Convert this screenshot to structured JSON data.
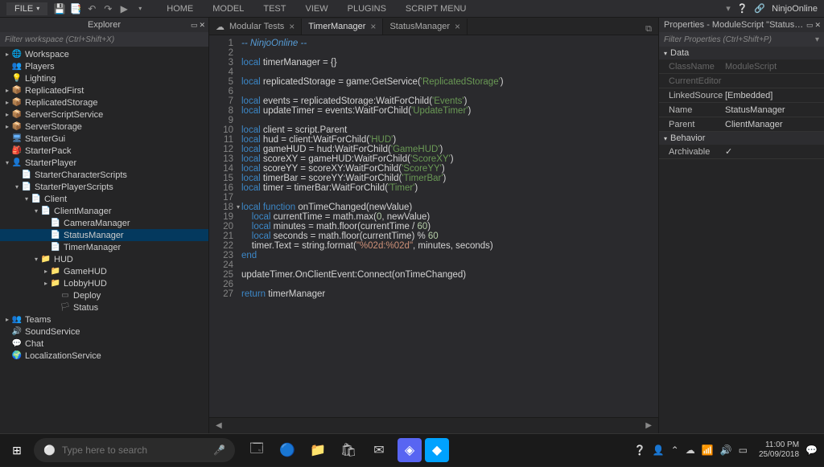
{
  "menubar": {
    "file_label": "FILE",
    "tabs": [
      "HOME",
      "MODEL",
      "TEST",
      "VIEW",
      "PLUGINS",
      "SCRIPT MENU"
    ],
    "username": "NinjoOnline"
  },
  "explorer": {
    "title": "Explorer",
    "filter_placeholder": "Filter workspace (Ctrl+Shift+X)",
    "tree": [
      {
        "indent": 0,
        "arrow": ">",
        "icon": "🌐",
        "cls": "ic-workspace",
        "label": "Workspace"
      },
      {
        "indent": 0,
        "arrow": "",
        "icon": "👥",
        "cls": "ic-players",
        "label": "Players"
      },
      {
        "indent": 0,
        "arrow": "",
        "icon": "💡",
        "cls": "ic-lighting",
        "label": "Lighting"
      },
      {
        "indent": 0,
        "arrow": ">",
        "icon": "📦",
        "cls": "ic-folder",
        "label": "ReplicatedFirst"
      },
      {
        "indent": 0,
        "arrow": ">",
        "icon": "📦",
        "cls": "ic-folder",
        "label": "ReplicatedStorage"
      },
      {
        "indent": 0,
        "arrow": ">",
        "icon": "📦",
        "cls": "ic-folder",
        "label": "ServerScriptService"
      },
      {
        "indent": 0,
        "arrow": ">",
        "icon": "📦",
        "cls": "ic-folder",
        "label": "ServerStorage"
      },
      {
        "indent": 0,
        "arrow": "",
        "icon": "🖥",
        "cls": "ic-gui",
        "label": "StarterGui"
      },
      {
        "indent": 0,
        "arrow": "",
        "icon": "🎒",
        "cls": "ic-folder",
        "label": "StarterPack"
      },
      {
        "indent": 0,
        "arrow": "v",
        "icon": "👤",
        "cls": "ic-players",
        "label": "StarterPlayer"
      },
      {
        "indent": 1,
        "arrow": "",
        "icon": "📄",
        "cls": "ic-script",
        "label": "StarterCharacterScripts"
      },
      {
        "indent": 1,
        "arrow": "v",
        "icon": "📄",
        "cls": "ic-script",
        "label": "StarterPlayerScripts"
      },
      {
        "indent": 2,
        "arrow": "v",
        "icon": "📄",
        "cls": "ic-script",
        "label": "Client"
      },
      {
        "indent": 3,
        "arrow": "v",
        "icon": "📄",
        "cls": "ic-module",
        "label": "ClientManager"
      },
      {
        "indent": 4,
        "arrow": "",
        "icon": "📄",
        "cls": "ic-module",
        "label": "CameraManager"
      },
      {
        "indent": 4,
        "arrow": "",
        "icon": "📄",
        "cls": "ic-module",
        "label": "StatusManager",
        "selected": true
      },
      {
        "indent": 4,
        "arrow": "",
        "icon": "📄",
        "cls": "ic-module",
        "label": "TimerManager"
      },
      {
        "indent": 3,
        "arrow": "v",
        "icon": "📁",
        "cls": "ic-folder",
        "label": "HUD"
      },
      {
        "indent": 4,
        "arrow": ">",
        "icon": "📁",
        "cls": "ic-folder",
        "label": "GameHUD"
      },
      {
        "indent": 4,
        "arrow": ">",
        "icon": "📁",
        "cls": "ic-folder",
        "label": "LobbyHUD"
      },
      {
        "indent": 5,
        "arrow": "",
        "icon": "▭",
        "cls": "ic-frame",
        "label": "Deploy"
      },
      {
        "indent": 5,
        "arrow": "",
        "icon": "🏳",
        "cls": "ic-frame",
        "label": "Status"
      },
      {
        "indent": 0,
        "arrow": ">",
        "icon": "👥",
        "cls": "ic-players",
        "label": "Teams"
      },
      {
        "indent": 0,
        "arrow": "",
        "icon": "🔊",
        "cls": "ic-service",
        "label": "SoundService"
      },
      {
        "indent": 0,
        "arrow": "",
        "icon": "💬",
        "cls": "ic-service",
        "label": "Chat"
      },
      {
        "indent": 0,
        "arrow": "",
        "icon": "🌍",
        "cls": "ic-service",
        "label": "LocalizationService"
      }
    ]
  },
  "editor": {
    "tabs": [
      {
        "icon": "☁",
        "label": "Modular Tests",
        "active": false
      },
      {
        "icon": "",
        "label": "TimerManager",
        "active": true
      },
      {
        "icon": "",
        "label": "StatusManager",
        "active": false
      }
    ],
    "code_lines": [
      {
        "n": 1,
        "html": "<span class='cmt'>-- NinjoOnline --</span>"
      },
      {
        "n": 2,
        "html": ""
      },
      {
        "n": 3,
        "html": "<span class='kw'>local</span> timerManager = {}"
      },
      {
        "n": 4,
        "html": ""
      },
      {
        "n": 5,
        "html": "<span class='kw'>local</span> replicatedStorage = game:GetService(<span class='str2'>'ReplicatedStorage'</span>)"
      },
      {
        "n": 6,
        "html": ""
      },
      {
        "n": 7,
        "html": "<span class='kw'>local</span> events = replicatedStorage:WaitForChild(<span class='str2'>'Events'</span>)"
      },
      {
        "n": 8,
        "html": "<span class='kw'>local</span> updateTimer = events:WaitForChild(<span class='str2'>'UpdateTimer'</span>)"
      },
      {
        "n": 9,
        "html": ""
      },
      {
        "n": 10,
        "html": "<span class='kw'>local</span> client = script.Parent"
      },
      {
        "n": 11,
        "html": "<span class='kw'>local</span> hud = client:WaitForChild(<span class='str2'>'HUD'</span>)"
      },
      {
        "n": 12,
        "html": "<span class='kw'>local</span> gameHUD = hud:WaitForChild(<span class='str2'>'GameHUD'</span>)"
      },
      {
        "n": 13,
        "html": "<span class='kw'>local</span> scoreXY = gameHUD:WaitForChild(<span class='str2'>'ScoreXY'</span>)"
      },
      {
        "n": 14,
        "html": "<span class='kw'>local</span> scoreYY = scoreXY:WaitForChild(<span class='str2'>'ScoreYY'</span>)"
      },
      {
        "n": 15,
        "html": "<span class='kw'>local</span> timerBar = scoreYY:WaitForChild(<span class='str2'>'TimerBar'</span>)"
      },
      {
        "n": 16,
        "html": "<span class='kw'>local</span> timer = timerBar:WaitForChild(<span class='str2'>'Timer'</span>)"
      },
      {
        "n": 17,
        "html": ""
      },
      {
        "n": 18,
        "html": "<span class='kw'>local</span> <span class='fn'>function</span> onTimeChanged(newValue)",
        "fold": true
      },
      {
        "n": 19,
        "html": "    <span class='kw'>local</span> currentTime = math.max(<span class='num'>0</span>, newValue)"
      },
      {
        "n": 20,
        "html": "    <span class='kw'>local</span> minutes = math.floor(currentTime / <span class='num'>60</span>)"
      },
      {
        "n": 21,
        "html": "    <span class='kw'>local</span> seconds = math.floor(currentTime) % <span class='num'>60</span>"
      },
      {
        "n": 22,
        "html": "    timer.Text = string.format(<span class='str'>\"%02d:%02d\"</span>, minutes, seconds)"
      },
      {
        "n": 23,
        "html": "<span class='kw'>end</span>"
      },
      {
        "n": 24,
        "html": ""
      },
      {
        "n": 25,
        "html": "updateTimer.OnClientEvent:Connect(onTimeChanged)"
      },
      {
        "n": 26,
        "html": ""
      },
      {
        "n": 27,
        "html": "<span class='kw'>return</span> timerManager"
      }
    ]
  },
  "properties": {
    "title": "Properties - ModuleScript \"StatusManager\"",
    "filter_placeholder": "Filter Properties (Ctrl+Shift+P)",
    "sections": [
      {
        "title": "Data",
        "rows": [
          {
            "key": "ClassName",
            "val": "ModuleScript",
            "dim": true
          },
          {
            "key": "CurrentEditor",
            "val": "",
            "dim": true
          },
          {
            "key": "LinkedSource",
            "val": "[Embedded]"
          },
          {
            "key": "Name",
            "val": "StatusManager"
          },
          {
            "key": "Parent",
            "val": "ClientManager"
          }
        ]
      },
      {
        "title": "Behavior",
        "rows": [
          {
            "key": "Archivable",
            "val": "✓",
            "check": true
          }
        ]
      }
    ]
  },
  "taskbar": {
    "search_placeholder": "Type here to search",
    "time": "11:00 PM",
    "date": "25/09/2018"
  }
}
